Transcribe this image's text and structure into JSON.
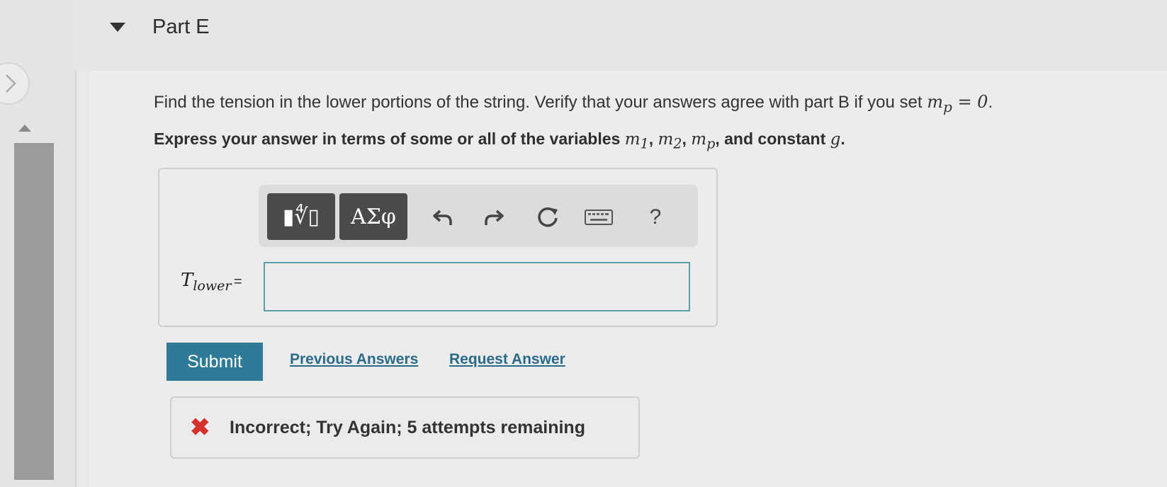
{
  "part": {
    "title": "Part E"
  },
  "question": {
    "text_before": "Find the tension in the lower portions of the string. Verify that your answers agree with part B if you set ",
    "math_mp": "m",
    "math_mp_sub": "p",
    "math_eq": " = 0",
    "text_after": "."
  },
  "instruction": {
    "text_before": "Express your answer in terms of some or all of the variables ",
    "var1": "m",
    "var1_sub": "1",
    "sep1": ", ",
    "var2": "m",
    "var2_sub": "2",
    "sep2": ", ",
    "var3": "m",
    "var3_sub": "p",
    "text_mid": ", and constant ",
    "var4": "g",
    "text_end": "."
  },
  "toolbar": {
    "templates_label": "▮∜▯",
    "greek_label": "ΑΣφ",
    "undo_icon": "undo-icon",
    "redo_icon": "redo-icon",
    "reset_icon": "reset-icon",
    "keyboard_icon": "keyboard-icon",
    "help_label": "?"
  },
  "answer": {
    "label_main": "T",
    "label_sub": "lower",
    "equals": "=",
    "value": ""
  },
  "actions": {
    "submit_label": "Submit",
    "previous_answers_label": "Previous Answers",
    "request_answer_label": "Request Answer"
  },
  "feedback": {
    "icon": "x-icon",
    "text": "Incorrect; Try Again; 5 attempts remaining",
    "color": "#d4322c"
  }
}
